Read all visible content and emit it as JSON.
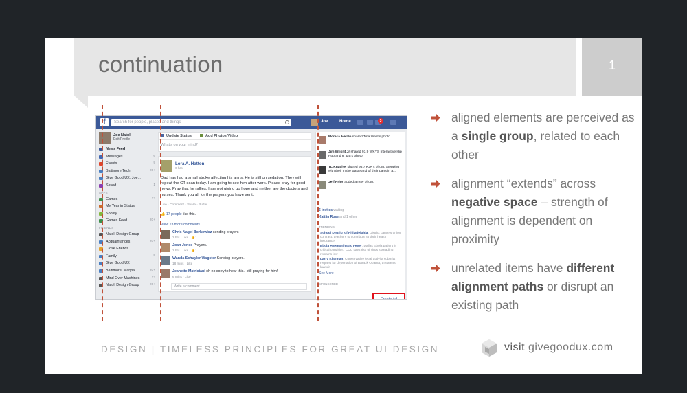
{
  "slide": {
    "title": "continuation",
    "number": "1",
    "footer_left": "DESIGN | TIMELESS PRINCIPLES FOR GREAT UI DESIGN",
    "footer_visit": "visit",
    "footer_site": "givegoodux.com"
  },
  "bullets": [
    {
      "pre": "aligned elements are perceived as a ",
      "bold": "single group",
      "post": ", related to each other"
    },
    {
      "pre": "alignment “extends” across ",
      "bold": "negative space",
      "post": " – strength of alignment is dependent on proximity"
    },
    {
      "pre": "unrelated items have ",
      "bold": "different alignment paths",
      "post": " or disrupt an existing path"
    }
  ],
  "colors": {
    "accent": "#c0523a",
    "fb_blue": "#3b5998",
    "highlight": "#e0121c"
  },
  "fb": {
    "search_placeholder": "Search for people, places and things",
    "nav_user": "Joe",
    "nav_home": "Home",
    "notif_count": "3",
    "profile_name": "Joe Natoli",
    "profile_edit": "Edit Profile",
    "left_items": [
      {
        "label": "News Feed",
        "count": "",
        "icon": "#3b5998"
      },
      {
        "label": "Messages",
        "count": "6",
        "icon": "#4267b2"
      },
      {
        "label": "Events",
        "count": "9",
        "icon": "#e0452b"
      },
      {
        "label": "Baltimore Tech",
        "count": "20+",
        "icon": "#4a7fc2"
      },
      {
        "label": "Give Good UX: Joe...",
        "count": "",
        "icon": "#4a7fc2"
      },
      {
        "label": "Saved",
        "count": "1",
        "icon": "#8b3fb0"
      }
    ],
    "apps_header": "APPS",
    "app_items": [
      {
        "label": "Games",
        "count": "13",
        "icon": "#3f8f4b"
      },
      {
        "label": "My Year in Status",
        "count": "",
        "icon": "#c96b2c"
      },
      {
        "label": "Spotify",
        "count": "",
        "icon": "#85b73e"
      },
      {
        "label": "Games Feed",
        "count": "20+",
        "icon": "#3f8f4b"
      }
    ],
    "friends_header": "FRIENDS",
    "friend_items": [
      {
        "label": "Natoli Design Group",
        "count": "",
        "icon": "#555"
      },
      {
        "label": "Acquaintances",
        "count": "20+",
        "icon": "#4a7fc2"
      },
      {
        "label": "Close Friends",
        "count": "",
        "icon": "#e6a32e"
      },
      {
        "label": "Family",
        "count": "9",
        "icon": "#4a7fc2"
      },
      {
        "label": "Give Good UX",
        "count": "",
        "icon": "#4a7fc2"
      },
      {
        "label": "Baltimore, Maryla...",
        "count": "20+",
        "icon": "#4a7fc2"
      },
      {
        "label": "Mind Over Machines",
        "count": "13",
        "icon": "#555"
      },
      {
        "label": "Natoli Design Group",
        "count": "20+",
        "icon": "#555"
      }
    ],
    "update_status": "Update Status",
    "add_photos": "Add Photos/Video",
    "whats_on_mind": "What's on your mind?",
    "post_author": "Lora A. Hatton",
    "post_time": "6 hrs ·",
    "post_text": "Dad has had a small stroke affecting his arms. He is still on sedation. They will repeat the CT scan today. I am going to see him after work. Please pray for good news. Pray that he rallies. I am not giving up hope and neither are the doctors and nurses. Thank you all for the prayers you have sent.",
    "post_actions": "Like · Comment · Share · Buffer",
    "post_likes_count": "17 people",
    "post_likes_suffix": " like this.",
    "view_more": "View 23 more comments",
    "comments": [
      {
        "name": "Chris Nagel Borkowicz",
        "text": " sending prayers",
        "meta": "2 hrs · Like · 👍1"
      },
      {
        "name": "Joan Jones",
        "text": " Prayers.",
        "meta": "2 hrs · Like · 👍1"
      },
      {
        "name": "Wanda Schuyler Wagster",
        "text": " Sending prayers.",
        "meta": "18 mins · Like"
      },
      {
        "name": "Jeanette Matriciani",
        "text": " oh no sorry to hear this.. still praying for him!",
        "meta": "6 mins · Like"
      }
    ],
    "write_comment": "Write a comment...",
    "ticker": [
      {
        "name": "Monica Mellilo",
        "text": " shared Tina West's photo."
      },
      {
        "name": "Jim Wright Jr",
        "text": " shared 93.9 WKYS Interactive Hip Hop and R & B's photo."
      },
      {
        "name": "TL Knachel",
        "text": " shared 95.7 KJR's photo. Stepping with their in the wasteland of their parts in a..."
      },
      {
        "name": "Jeff Price",
        "text": " added a new photo."
      }
    ],
    "invites": "6 invites",
    "invites_suffix": " waiting",
    "kaitlin": "Kaitlin Rose",
    "kaitlin_suffix": " and 1 other",
    "trending_header": "TRENDING",
    "trends": [
      {
        "name": "School District of Philadelphia",
        "text": ": District cancels union contract; teachers to contribute to their health insurance"
      },
      {
        "name": "Ebola Haemorrhagic Fever",
        "text": ": Dallas Ebola patient in critical condition, CDC says risk of virus spreading remains low"
      },
      {
        "name": "Larry Klayman",
        "text": ": Conservative legal activist submits request for deportation of Barack Obama; threatens lawsuit"
      }
    ],
    "see_more": "See More",
    "sponsored": "SPONSORED",
    "create_ad": "Create Ad"
  }
}
